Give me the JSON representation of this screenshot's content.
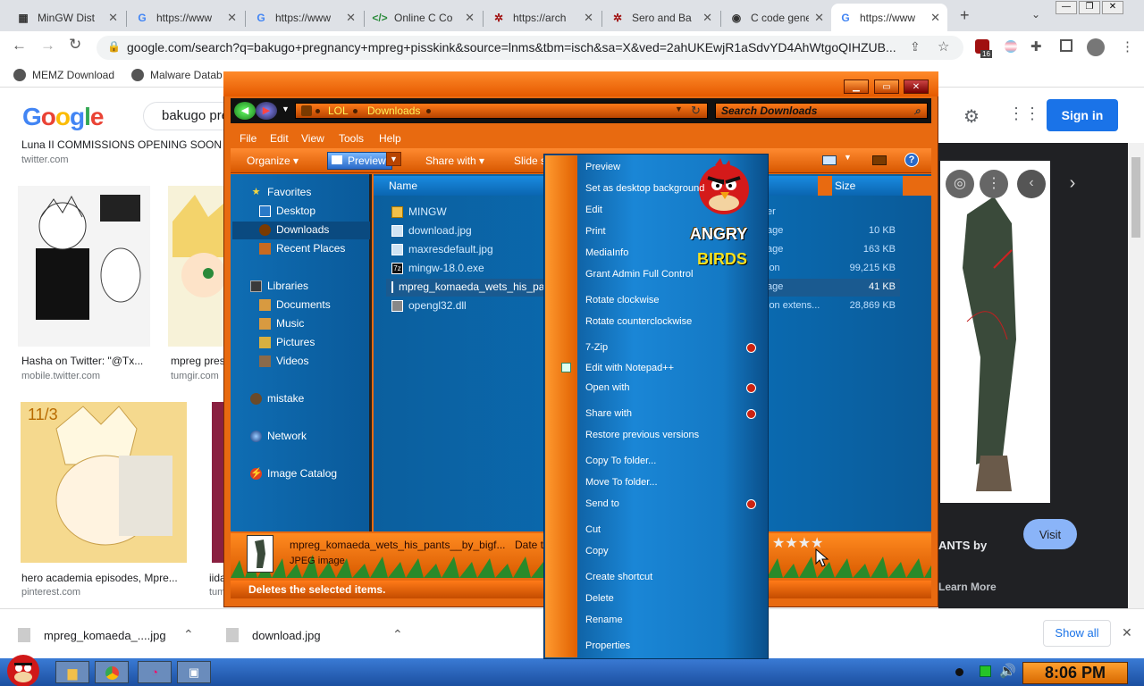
{
  "browser": {
    "tabs": [
      {
        "label": "MinGW Dist",
        "icon": "page-icon"
      },
      {
        "label": "https://www",
        "icon": "google-icon"
      },
      {
        "label": "https://www",
        "icon": "google-icon"
      },
      {
        "label": "Online C Co",
        "icon": "code-icon"
      },
      {
        "label": "https://arch",
        "icon": "archive-icon"
      },
      {
        "label": "Sero and Ba",
        "icon": "archive-icon"
      },
      {
        "label": "C code gene",
        "icon": "codegen-icon"
      },
      {
        "label": "https://www",
        "icon": "google-icon"
      }
    ],
    "url": "google.com/search?q=bakugo+pregnancy+mpreg+pisskink&source=lnms&tbm=isch&sa=X&ved=2ahUKEwjR1aSdvYD4AhWtgoQIHZUB...",
    "extension_badge": "16",
    "bookmarks": [
      {
        "label": "MEMZ Download"
      },
      {
        "label": "Malware Datab"
      }
    ]
  },
  "google": {
    "logo": "Google",
    "query": "bakugo pre",
    "sign_in": "Sign in",
    "top_result": {
      "caption": "Luna II COMMISSIONS OPENING SOON o",
      "source": "twitter.com"
    },
    "results": [
      {
        "caption": "Hasha on Twitter: \"@Tx...",
        "source": "mobile.twitter.com"
      },
      {
        "caption": "mpreg pres",
        "source": "tumgir.com"
      },
      {
        "caption": "hero academia episodes, Mpre...",
        "source": "pinterest.com"
      },
      {
        "caption": "iida",
        "source": "tum"
      }
    ],
    "thumb_date": "11/3",
    "preview": {
      "title": "ANTS by",
      "learn_more": "Learn More",
      "visit": "Visit"
    }
  },
  "downloads": {
    "items": [
      "mpreg_komaeda_....jpg",
      "download.jpg"
    ],
    "show_all": "Show all"
  },
  "explorer": {
    "breadcrumb": [
      "LOL",
      "Downloads"
    ],
    "search_placeholder": "Search Downloads",
    "menu": [
      "File",
      "Edit",
      "View",
      "Tools",
      "Help"
    ],
    "commands": {
      "organize": "Organize",
      "preview": "Preview",
      "share": "Share with",
      "slide": "Slide s"
    },
    "nav": {
      "favorites": "Favorites",
      "fav_items": [
        "Desktop",
        "Downloads",
        "Recent Places"
      ],
      "libraries": "Libraries",
      "lib_items": [
        "Documents",
        "Music",
        "Pictures",
        "Videos"
      ],
      "mistake": "mistake",
      "network": "Network",
      "image_catalog": "Image Catalog"
    },
    "columns": {
      "name": "Name",
      "size": "Size",
      "type_partial": "er"
    },
    "files": [
      {
        "name": "MINGW",
        "icon": "folder-icon",
        "type": "",
        "size": ""
      },
      {
        "name": "download.jpg",
        "icon": "image-file-icon",
        "type": "age",
        "size": "10 KB"
      },
      {
        "name": "maxresdefault.jpg",
        "icon": "image-file-icon",
        "type": "age",
        "size": "163 KB"
      },
      {
        "name": "mingw-18.0.exe",
        "icon": "7zip-exe-icon",
        "type": "ion",
        "size": "99,215 KB"
      },
      {
        "name": "mpreg_komaeda_wets_his_pa",
        "icon": "image-file-icon",
        "type": "age",
        "size": "41 KB"
      },
      {
        "name": "opengl32.dll",
        "icon": "dll-file-icon",
        "type": "ion extens...",
        "size": "28,869 KB"
      }
    ],
    "details": {
      "name": "mpreg_komaeda_wets_his_pants__by_bigf...",
      "date": "Date t",
      "type": "JPEG image",
      "rating": "★★★★"
    },
    "status": "Deletes the selected items."
  },
  "context_menu": {
    "items": [
      {
        "label": "Preview",
        "submenu": false
      },
      {
        "label": "Set as desktop background",
        "submenu": false
      },
      {
        "label": "Edit",
        "submenu": false
      },
      {
        "label": "Print",
        "submenu": false
      },
      {
        "label": "MediaInfo",
        "submenu": false
      },
      {
        "label": "Grant Admin Full Control",
        "submenu": false
      },
      {
        "label": "Rotate clockwise",
        "submenu": false
      },
      {
        "label": "Rotate counterclockwise",
        "submenu": false
      },
      {
        "label": "7-Zip",
        "submenu": true
      },
      {
        "label": "Edit with Notepad++",
        "submenu": false
      },
      {
        "label": "Open with",
        "submenu": true
      },
      {
        "label": "Share with",
        "submenu": true
      },
      {
        "label": "Restore previous versions",
        "submenu": false
      },
      {
        "label": "Copy To folder...",
        "submenu": false
      },
      {
        "label": "Move To folder...",
        "submenu": false
      },
      {
        "label": "Send to",
        "submenu": true
      },
      {
        "label": "Cut",
        "submenu": false
      },
      {
        "label": "Copy",
        "submenu": false
      },
      {
        "label": "Create shortcut",
        "submenu": false
      },
      {
        "label": "Delete",
        "submenu": false
      },
      {
        "label": "Rename",
        "submenu": false
      },
      {
        "label": "Properties",
        "submenu": false
      }
    ],
    "logo_line1": "ANGRY",
    "logo_line2": "BIRDS"
  },
  "taskbar": {
    "clock": "8:06 PM"
  },
  "colors": {
    "explorer_orange": "#e86a10",
    "explorer_blue": "#0a65b0",
    "google_blue": "#1a73e8"
  }
}
